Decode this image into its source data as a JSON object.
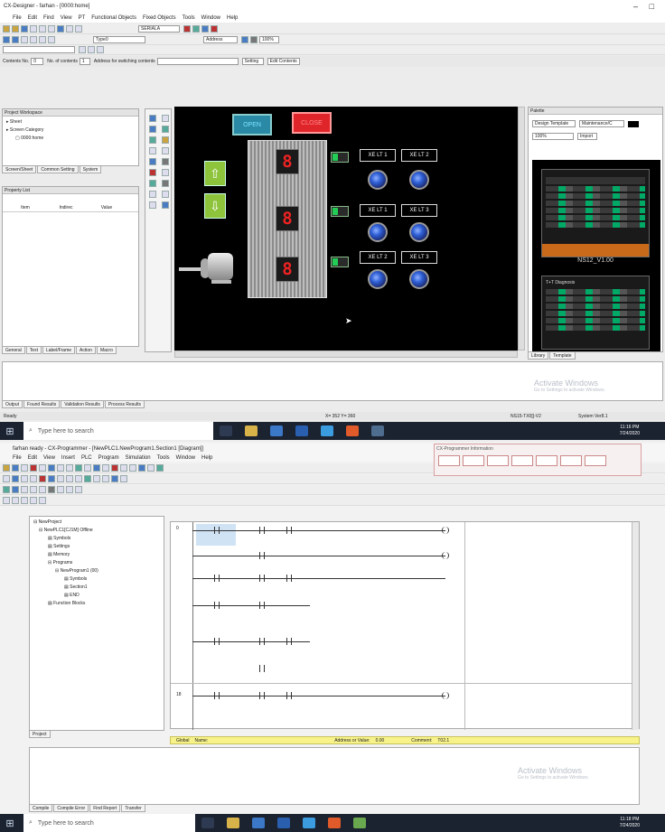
{
  "top": {
    "title": "CX-Designer - farhan - [0000:home]",
    "menu": [
      "File",
      "Edit",
      "Find",
      "View",
      "PT",
      "Functional Objects",
      "Fixed Objects",
      "Tools",
      "Window",
      "Help"
    ],
    "combos": {
      "serial": "SERIALA",
      "type": "Type0",
      "address": "Address",
      "zoom": "100%"
    },
    "contents_row": {
      "contents_no_label": "Contents No.",
      "contents_no": "0",
      "no_of_contents_label": "No. of contents",
      "no_of_contents": "1",
      "address_label": "Address for switching contents",
      "setting_btn": "Setting",
      "edit_btn": "Edit Contents"
    },
    "project_workspace": {
      "title": "Project Workspace",
      "items": [
        "Sheet",
        "Screen Category",
        "0000:home"
      ],
      "tabs": [
        "Screen/Sheet",
        "Common Setting",
        "System"
      ]
    },
    "property_list": {
      "title": "Property List",
      "cols": [
        "Item",
        "Indirec",
        "Value"
      ],
      "tabs": [
        "General",
        "Text",
        "Label/Frame",
        "Action",
        "Macro"
      ]
    },
    "hmi": {
      "open": "OPEN",
      "close": "CLOSE",
      "seg": [
        "8",
        "8",
        "8"
      ],
      "lamp_labels": [
        "XE LT 1",
        "XE LT 2",
        "XE LT 1",
        "XE LT 3",
        "XE LT 2",
        "XE LT 3"
      ]
    },
    "palette": {
      "title": "Palette",
      "design_template": "Design Template",
      "maintenance": "Maintenance/C",
      "zoom": "100%",
      "import": "Import",
      "model_label": "NS12_V1.00",
      "diag_title": "T+T Diagnosis",
      "tabs": [
        "Library",
        "Template"
      ]
    },
    "output_tabs": [
      "Output",
      "Found Results",
      "Validation Results",
      "Process Results"
    ],
    "activate": "Activate Windows",
    "activate_sub": "Go to Settings to activate Windows.",
    "status": {
      "ready": "Ready",
      "coords": "X= 352 Y= 360",
      "model": "NS15-TX0[]-V2",
      "sysver": "System Ver8.1"
    },
    "taskbar": {
      "search": "Type here to search",
      "time": "11:16 PM",
      "date": "7/24/2020"
    }
  },
  "bottom": {
    "title": "farhan ready - CX-Programmer - [NewPLC1.NewProgram1.Section1 [Diagram]]",
    "menu": [
      "File",
      "Edit",
      "View",
      "Insert",
      "PLC",
      "Program",
      "Simulation",
      "Tools",
      "Window",
      "Help"
    ],
    "info_title": "CX-Programmer Information",
    "tree": [
      "NewProject",
      "NewPLC1[CJ1M] Offline",
      "Symbols",
      "Settings",
      "Memory",
      "Programs",
      "NewProgram1 (00)",
      "Symbols",
      "Section1",
      "END",
      "Function Blocks"
    ],
    "project_tab": "Project",
    "rung_numbers": [
      "0",
      "18"
    ],
    "rung_steps": [
      "0",
      "",
      "",
      "",
      "",
      "",
      ""
    ],
    "yellowbar": {
      "global": "Global",
      "name": "Name:",
      "address": "Address or Value:",
      "address_val": "0.00",
      "comment": "Comment:",
      "comment_val": "T02.1"
    },
    "output_tabs": [
      "Compile",
      "Compile Error",
      "Find Report",
      "Transfer"
    ],
    "activate": "Activate Windows",
    "activate_sub": "Go to Settings to activate Windows.",
    "taskbar": {
      "search": "Type here to search",
      "time": "11:18 PM",
      "date": "7/24/2020"
    }
  }
}
